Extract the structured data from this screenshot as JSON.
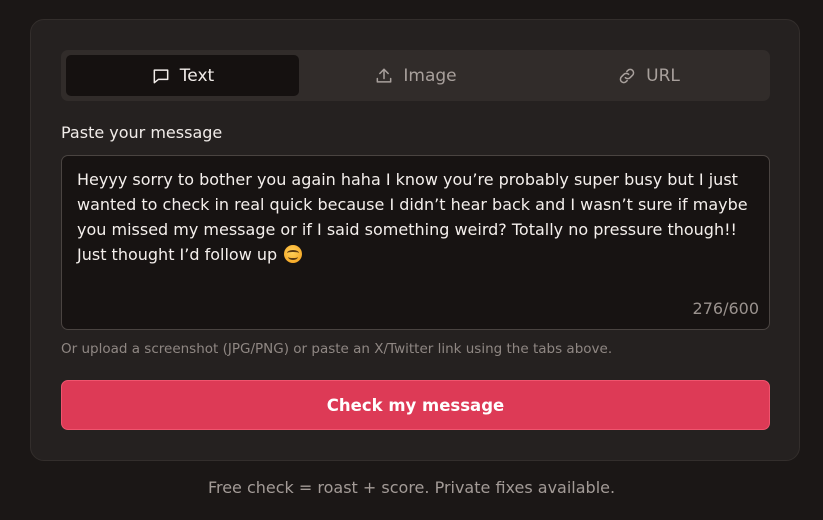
{
  "tabs": [
    {
      "label": "Text",
      "icon": "message-square-icon",
      "active": true
    },
    {
      "label": "Image",
      "icon": "upload-icon",
      "active": false
    },
    {
      "label": "URL",
      "icon": "link-icon",
      "active": false
    }
  ],
  "message": {
    "label": "Paste your message",
    "value": "Heyyy sorry to bother you again haha I know you’re probably super busy but I just wanted to check in real quick because I didn’t hear back and I wasn’t sure if maybe you missed my message or if I said something weird? Totally no pressure though!! Just thought I’d follow up",
    "emoji": "smiling-face-emoji",
    "counter": "276/600"
  },
  "hint": "Or upload a screenshot (JPG/PNG) or paste an X/Twitter link using the tabs above.",
  "cta_label": "Check my message",
  "footer": "Free check = roast + score. Private fixes available.",
  "colors": {
    "background": "#1b1716",
    "card": "#252120",
    "accent": "#dd3a56"
  }
}
